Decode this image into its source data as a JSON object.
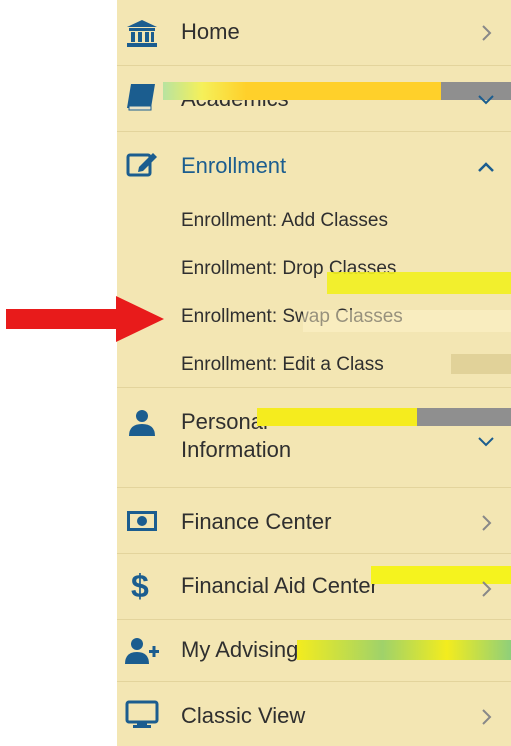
{
  "menu": {
    "items": [
      {
        "id": "home",
        "label": "Home",
        "icon": "bank-icon"
      },
      {
        "id": "academics",
        "label": "Academics",
        "icon": "book-icon"
      },
      {
        "id": "enrollment",
        "label": "Enrollment",
        "icon": "edit-icon",
        "expanded": true,
        "sub": [
          {
            "label": "Enrollment: Add Classes"
          },
          {
            "label": "Enrollment: Drop Classes"
          },
          {
            "label": "Enrollment: Swap Classes"
          },
          {
            "label": "Enrollment: Edit a Class"
          }
        ]
      },
      {
        "id": "personal",
        "label": "Personal Information",
        "icon": "person-icon"
      },
      {
        "id": "finance",
        "label": "Finance Center",
        "icon": "money-icon"
      },
      {
        "id": "financial-aid",
        "label": "Financial Aid Center",
        "icon": "dollar-icon"
      },
      {
        "id": "advising",
        "label": "My Advising Center",
        "icon": "add-user-icon"
      },
      {
        "id": "classic",
        "label": "Classic View",
        "icon": "monitor-icon"
      }
    ]
  },
  "colors": {
    "panel": "#f3e6b3",
    "accent": "#1b5d8f",
    "arrow": "#e81b1b"
  }
}
